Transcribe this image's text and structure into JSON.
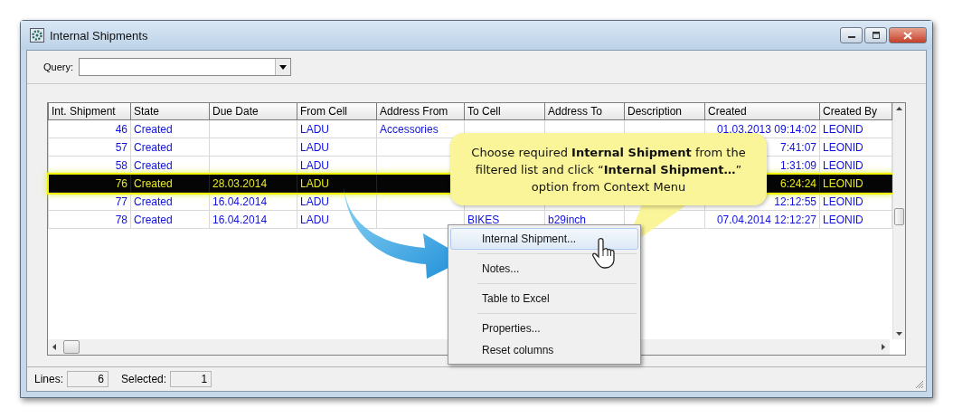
{
  "window": {
    "title": "Internal Shipments"
  },
  "query": {
    "label": "Query:"
  },
  "table": {
    "columns": [
      "Int. Shipment",
      "State",
      "Due Date",
      "From Cell",
      "Address From",
      "To Cell",
      "Address To",
      "Description",
      "Created",
      "Created By"
    ],
    "rows": [
      {
        "selected": false,
        "cells": [
          "46",
          "Created",
          null,
          "LADU",
          "Accessories",
          null,
          null,
          null,
          "01.03.2013 09:14:02",
          "LEONID"
        ]
      },
      {
        "selected": false,
        "cells": [
          "57",
          "Created",
          null,
          "LADU",
          null,
          null,
          null,
          null,
          "7:41:07",
          "LEONID"
        ]
      },
      {
        "selected": false,
        "cells": [
          "58",
          "Created",
          null,
          "LADU",
          null,
          null,
          null,
          null,
          "1:31:09",
          "LEONID"
        ]
      },
      {
        "selected": true,
        "cells": [
          "76",
          "Created",
          "28.03.2014",
          "LADU",
          null,
          null,
          null,
          null,
          "6:24:24",
          "LEONID"
        ]
      },
      {
        "selected": false,
        "cells": [
          "77",
          "Created",
          "16.04.2014",
          "LADU",
          null,
          null,
          null,
          null,
          "12:12:55",
          "LEONID"
        ]
      },
      {
        "selected": false,
        "cells": [
          "78",
          "Created",
          "16.04.2014",
          "LADU",
          null,
          "BIKES",
          "b29inch",
          null,
          "07.04.2014 12:12:27",
          "LEONID"
        ]
      }
    ]
  },
  "callout": {
    "text": "Choose required **Internal Shipment** from the filtered list and click “**Internal Shipment…**” option from Context Menu"
  },
  "context_menu": {
    "groups": [
      [
        {
          "label": "Internal Shipment...",
          "selected": true
        }
      ],
      [
        {
          "label": "Notes...",
          "selected": false
        }
      ],
      [
        {
          "label": "Table to Excel",
          "selected": false
        }
      ],
      [
        {
          "label": "Properties...",
          "selected": false
        },
        {
          "label": "Reset columns",
          "selected": false
        }
      ]
    ]
  },
  "status_bar": {
    "lines_label": "Lines:",
    "lines": "6",
    "selected_label": "Selected:",
    "selected": "1"
  }
}
